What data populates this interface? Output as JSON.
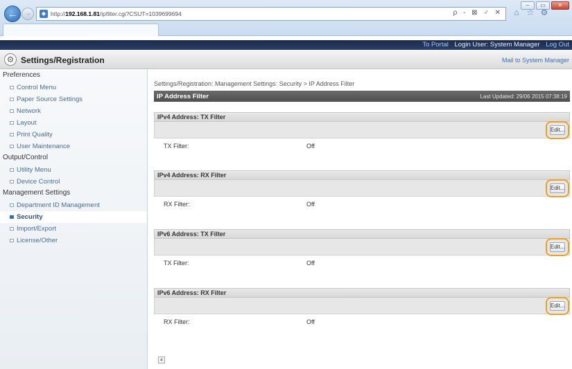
{
  "browser": {
    "url_prefix": "http://",
    "url_host": "192.168.1.81",
    "url_path": "/ipfilter.cgi?CSUT=1039699694",
    "tab_title": "",
    "address_tools": "ρ - ⊠ ♂ ✕",
    "controls": {
      "minimize": "–",
      "maximize": "▭",
      "close": "✕"
    }
  },
  "portal_bar": {
    "to_portal": "To Portal",
    "login_user": "Login User: System Manager",
    "log_out": "Log Out"
  },
  "header": {
    "title": "Settings/Registration",
    "mail_link": "Mail to System Manager"
  },
  "sidebar": {
    "groups": [
      {
        "label": "Preferences",
        "items": [
          "Control Menu",
          "Paper Source Settings",
          "Network",
          "Layout",
          "Print Quality",
          "User Maintenance"
        ]
      },
      {
        "label": "Output/Control",
        "items": [
          "Utility Menu",
          "Device Control"
        ]
      },
      {
        "label": "Management Settings",
        "items": [
          "Department ID Management",
          "Security",
          "Import/Export",
          "License/Other"
        ]
      }
    ],
    "active_item": "Security"
  },
  "main": {
    "breadcrumb": "Settings/Registration: Management Settings: Security > IP Address Filter",
    "title": "IP Address Filter",
    "last_updated": "Last Updated: 29/06 2015 07:38:19",
    "edit_label": "Edit...",
    "sections": [
      {
        "header": "IPv4 Address: TX Filter",
        "row_label": "TX Filter:",
        "row_value": "Off"
      },
      {
        "header": "IPv4 Address: RX Filter",
        "row_label": "RX Filter:",
        "row_value": "Off"
      },
      {
        "header": "IPv6 Address: TX Filter",
        "row_label": "TX Filter:",
        "row_value": "Off"
      },
      {
        "header": "IPv6 Address: RX Filter",
        "row_label": "RX Filter:",
        "row_value": "Off"
      }
    ]
  },
  "colors": {
    "portal_bar": "#1d2b4a",
    "title_bar": "#5a5a5a",
    "highlight": "#f0a020",
    "link": "#3b6fb6"
  }
}
